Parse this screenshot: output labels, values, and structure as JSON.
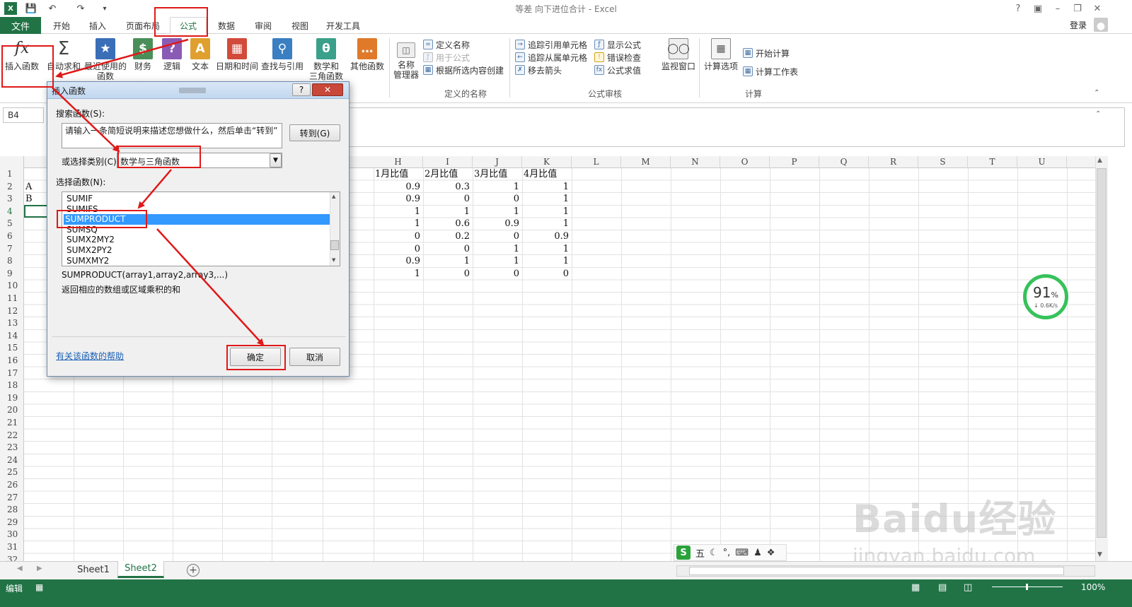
{
  "window": {
    "title": "等差 向下进位合计 - Excel",
    "login": "登录"
  },
  "ribbon_tabs": [
    "文件",
    "开始",
    "插入",
    "页面布局",
    "公式",
    "数据",
    "审阅",
    "视图",
    "开发工具"
  ],
  "ribbon": {
    "buttons": [
      "插入函数",
      "自动求和",
      "最近使用的\n函数",
      "财务",
      "逻辑",
      "文本",
      "日期和时间",
      "查找与引用",
      "数学和\n三角函数",
      "其他函数"
    ],
    "names_manager": "名称\n管理器",
    "defined_names": [
      "定义名称",
      "用于公式",
      "根据所选内容创建"
    ],
    "audit": [
      "追踪引用单元格",
      "追踪从属单元格",
      "移去箭头",
      "显示公式",
      "错误检查",
      "公式求值"
    ],
    "watch_window": "监视窗口",
    "calc_options": "计算选项",
    "calc": [
      "开始计算",
      "计算工作表"
    ],
    "group_labels": [
      "定义的名称",
      "公式审核",
      "计算"
    ]
  },
  "name_box": "B4",
  "columns": [
    "H",
    "I",
    "J",
    "K",
    "L",
    "M",
    "N",
    "O",
    "P",
    "Q",
    "R",
    "S",
    "T",
    "U"
  ],
  "rows": [
    "1",
    "2",
    "3",
    "4",
    "5",
    "6",
    "7",
    "8",
    "9",
    "10",
    "11",
    "12",
    "13",
    "14",
    "15",
    "16",
    "17",
    "18",
    "19",
    "20",
    "21",
    "22",
    "23",
    "24",
    "25",
    "26",
    "27",
    "28",
    "29",
    "30",
    "31",
    "32"
  ],
  "col_a_values": [
    "",
    "A",
    "B"
  ],
  "table": {
    "headers": [
      "1月比值",
      "2月比值",
      "3月比值",
      "4月比值"
    ],
    "rows": [
      [
        "0.9",
        "0.3",
        "1",
        "1"
      ],
      [
        "0.9",
        "0",
        "0",
        "1"
      ],
      [
        "1",
        "1",
        "1",
        "1"
      ],
      [
        "1",
        "0.6",
        "0.9",
        "1"
      ],
      [
        "0",
        "0.2",
        "0",
        "0.9"
      ],
      [
        "0",
        "0",
        "1",
        "1"
      ],
      [
        "0.9",
        "1",
        "1",
        "1"
      ],
      [
        "1",
        "0",
        "0",
        "0"
      ]
    ]
  },
  "dialog": {
    "title": "插入函数",
    "search_label": "搜索函数(S):",
    "search_text": "请输入一条简短说明来描述您想做什么，然后单击“转到”",
    "goto_button": "转到(G)",
    "category_label": "或选择类别(C):",
    "category_value": "数学与三角函数",
    "select_label": "选择函数(N):",
    "functions": [
      "SUMIF",
      "SUMIFS",
      "SUMPRODUCT",
      "SUMSQ",
      "SUMX2MY2",
      "SUMX2PY2",
      "SUMXMY2"
    ],
    "selected_function": "SUMPRODUCT",
    "syntax": "SUMPRODUCT(array1,array2,array3,...)",
    "description": "返回相应的数组或区域乘积的和",
    "help_link": "有关该函数的帮助",
    "ok_button": "确定",
    "cancel_button": "取消",
    "help_icon": "?",
    "close_icon": "✕"
  },
  "sheets": [
    "Sheet1",
    "Sheet2"
  ],
  "active_sheet": "Sheet2",
  "status": {
    "mode": "编辑",
    "zoom": "100%"
  },
  "network_widget": {
    "percent": "91",
    "unit": "%",
    "speed": "0.6K/s"
  },
  "ime_toolbar": "五",
  "watermark": {
    "logo": "Baidu经验",
    "url": "jingyan.baidu.com"
  },
  "colors": {
    "excel_green": "#217346",
    "annotation_red": "#e01818",
    "selection_blue": "#3399ff"
  }
}
